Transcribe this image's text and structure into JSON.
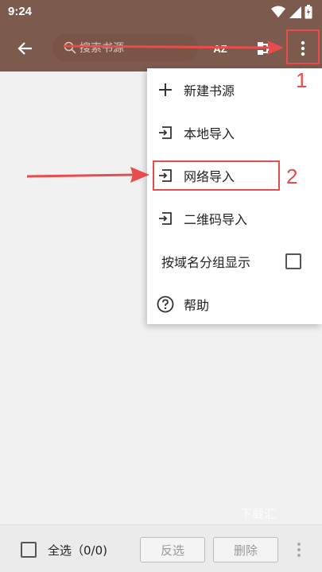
{
  "status_bar": {
    "time": "9:24",
    "icons": [
      "wifi-icon",
      "signal-icon",
      "battery-icon"
    ]
  },
  "toolbar": {
    "search_placeholder": "搜索书源",
    "sort_icon_text": "AZ",
    "icons": [
      "back-arrow-icon",
      "search-icon",
      "sort-icon",
      "group-icon",
      "more-vert-icon"
    ]
  },
  "menu": {
    "items": [
      {
        "label": "新建书源",
        "icon": "plus-icon"
      },
      {
        "label": "本地导入",
        "icon": "import-icon"
      },
      {
        "label": "网络导入",
        "icon": "import-icon"
      },
      {
        "label": "二维码导入",
        "icon": "import-icon"
      },
      {
        "label": "按域名分组显示",
        "icon": "checkbox-icon",
        "checked": false
      },
      {
        "label": "帮助",
        "icon": "help-icon"
      }
    ]
  },
  "annotations": {
    "label_1": "1",
    "label_2": "2",
    "color": "#e84c4c"
  },
  "bottom_bar": {
    "select_all_label": "全选（0/0)",
    "invert_label": "反选",
    "delete_label": "删除"
  },
  "watermark": "下载汇",
  "colors": {
    "toolbar": "#7d5a4e",
    "background": "#f1f1f1",
    "annotation": "#e84c4c"
  }
}
